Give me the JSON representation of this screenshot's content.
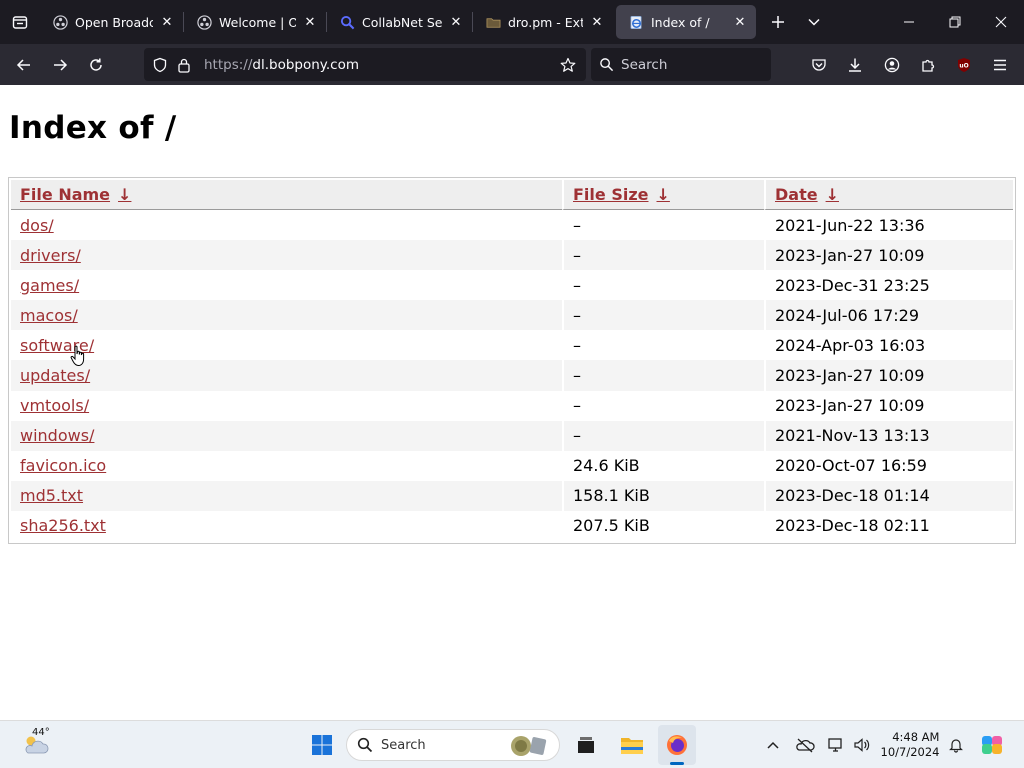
{
  "browser": {
    "tabs": [
      {
        "title": "Open Broadcast",
        "icon": "obs-icon",
        "active": false
      },
      {
        "title": "Welcome | OBS",
        "icon": "obs-icon",
        "active": false
      },
      {
        "title": "CollabNet Search",
        "icon": "search-icon",
        "active": false
      },
      {
        "title": "dro.pm - Extreme",
        "icon": "folder-icon",
        "active": false
      },
      {
        "title": "Index of /",
        "icon": "ie-icon",
        "active": true
      }
    ],
    "url": {
      "scheme": "https://",
      "host": "dl.bobpony.com"
    },
    "search_placeholder": "Search"
  },
  "page": {
    "heading": "Index of /",
    "columns": [
      {
        "label": "File Name",
        "sort_arrow": "↓"
      },
      {
        "label": "File Size",
        "sort_arrow": "↓"
      },
      {
        "label": "Date",
        "sort_arrow": "↓"
      }
    ],
    "rows": [
      {
        "name": "dos/",
        "size": "–",
        "date": "2021-Jun-22 13:36"
      },
      {
        "name": "drivers/",
        "size": "–",
        "date": "2023-Jan-27 10:09"
      },
      {
        "name": "games/",
        "size": "–",
        "date": "2023-Dec-31 23:25"
      },
      {
        "name": "macos/",
        "size": "–",
        "date": "2024-Jul-06 17:29"
      },
      {
        "name": "software/",
        "size": "–",
        "date": "2024-Apr-03 16:03"
      },
      {
        "name": "updates/",
        "size": "–",
        "date": "2023-Jan-27 10:09"
      },
      {
        "name": "vmtools/",
        "size": "–",
        "date": "2023-Jan-27 10:09"
      },
      {
        "name": "windows/",
        "size": "–",
        "date": "2021-Nov-13 13:13"
      },
      {
        "name": "favicon.ico",
        "size": "24.6 KiB",
        "date": "2020-Oct-07 16:59"
      },
      {
        "name": "md5.txt",
        "size": "158.1 KiB",
        "date": "2023-Dec-18 01:14"
      },
      {
        "name": "sha256.txt",
        "size": "207.5 KiB",
        "date": "2023-Dec-18 02:11"
      }
    ]
  },
  "taskbar": {
    "weather": {
      "temp": "44°",
      "icon": "weather-icon"
    },
    "search_placeholder": "Search",
    "time": "4:48 AM",
    "date": "10/7/2024"
  },
  "colors": {
    "link": "#9e3134",
    "tab_bar": "#1c1b22",
    "nav_bar": "#2b2a33",
    "active_tab": "#42414d",
    "taskbar": "#ecf1f6"
  }
}
